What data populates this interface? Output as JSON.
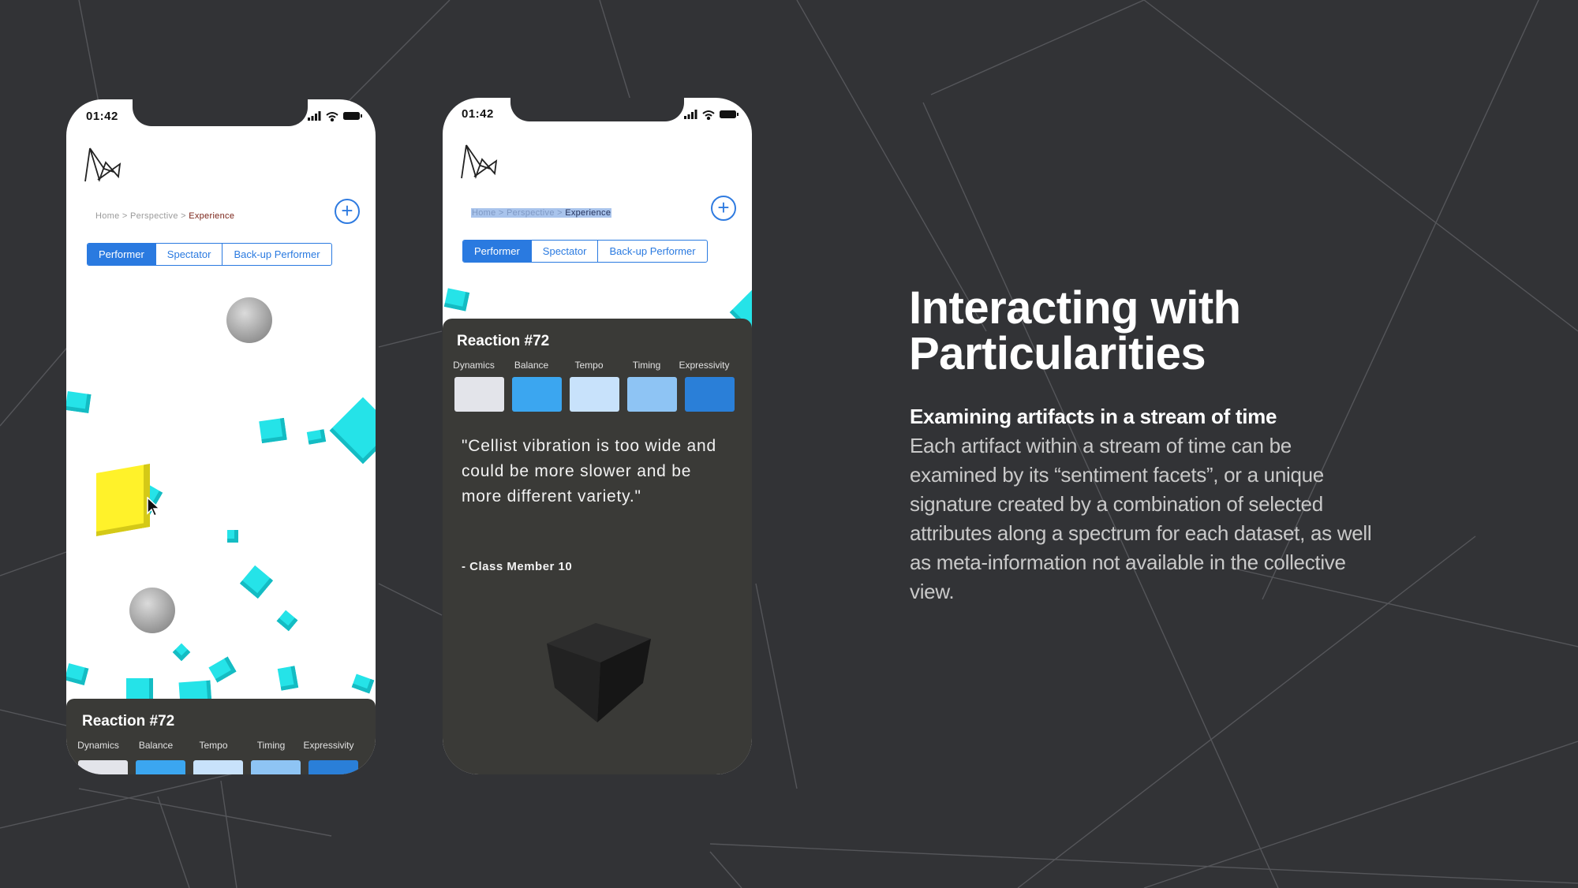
{
  "colors": {
    "background": "#323336",
    "accent_blue": "#2a7ae0",
    "cube_cyan": "#25e3e8",
    "cube_yellow": "#fff22a",
    "panel_dark": "#3a3a37"
  },
  "phone_left": {
    "status_time": "01:42",
    "breadcrumb": {
      "home": "Home",
      "sep1": " > ",
      "perspective": "Perspective",
      "sep2": " > ",
      "current": "Experience"
    },
    "tabs": [
      {
        "label": "Performer",
        "active": true
      },
      {
        "label": "Spectator",
        "active": false
      },
      {
        "label": "Back-up Performer",
        "active": false
      }
    ],
    "reaction": {
      "title": "Reaction #72",
      "facets": [
        "Dynamics",
        "Balance",
        "Tempo",
        "Timing",
        "Expressivity"
      ],
      "swatch_colors": [
        "#e3e4ea",
        "#3ba6f0",
        "#c8e2fb",
        "#8ec4f4",
        "#2a7fd8"
      ]
    }
  },
  "phone_right": {
    "status_time": "01:42",
    "breadcrumb": {
      "home": "Home",
      "sep1": " > ",
      "perspective": "Perspective",
      "sep2": " > ",
      "current": "Experience"
    },
    "tabs": [
      {
        "label": "Performer",
        "active": true
      },
      {
        "label": "Spectator",
        "active": false
      },
      {
        "label": "Back-up Performer",
        "active": false
      }
    ],
    "reaction": {
      "title": "Reaction #72",
      "facets": [
        "Dynamics",
        "Balance",
        "Tempo",
        "Timing",
        "Expressivity"
      ],
      "swatch_colors": [
        "#e3e4ea",
        "#3ba6f0",
        "#c8e2fb",
        "#8ec4f4",
        "#2a7fd8"
      ],
      "quote": "\"Cellist vibration is too wide and could be more slower and be more different variety.\"",
      "attribution": "- Class Member 10"
    }
  },
  "icons": [
    "logo-icon",
    "signal-icon",
    "wifi-icon",
    "battery-icon",
    "add-icon",
    "cursor-icon",
    "cube-icon"
  ],
  "slide": {
    "headline_line1": "Interacting with",
    "headline_line2": "Particularities",
    "subheading": "Examining artifacts in a stream of time",
    "body": "Each artifact within a stream of time can be examined by its “sentiment facets”, or a unique signature created by a combination of selected attributes along a spectrum for each dataset, as well as meta-information not available in the collective view."
  }
}
